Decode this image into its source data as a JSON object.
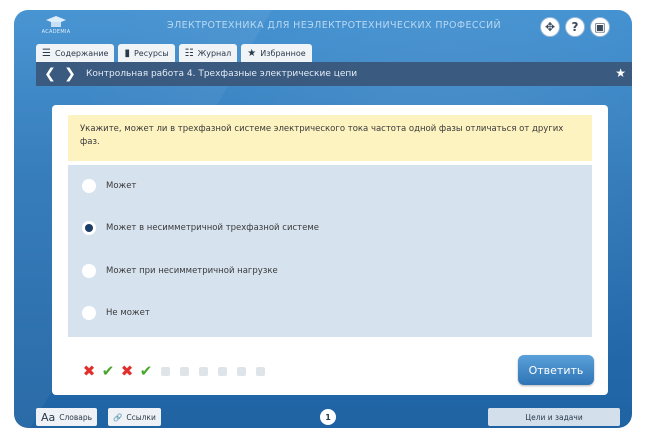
{
  "header": {
    "logo_text": "ACADEMIA",
    "title": "ЭЛЕКТРОТЕХНИКА ДЛЯ НЕЭЛЕКТРОТЕХНИЧЕСКИХ ПРОФЕССИЙ",
    "buttons": [
      {
        "name": "move-icon",
        "glyph": "✥"
      },
      {
        "name": "help-icon",
        "glyph": "?"
      },
      {
        "name": "save-icon",
        "glyph": "▣"
      }
    ]
  },
  "tabs": [
    {
      "label": "Содержание",
      "icon": "list-icon",
      "glyph": "☰"
    },
    {
      "label": "Ресурсы",
      "icon": "bar-chart-icon",
      "glyph": "▮"
    },
    {
      "label": "Журнал",
      "icon": "journal-icon",
      "glyph": "☷"
    },
    {
      "label": "Избранное",
      "icon": "star-icon",
      "glyph": "★"
    }
  ],
  "nav": {
    "back_glyph": "❮",
    "forward_glyph": "❯",
    "title": "Контрольная работа 4. Трехфазные электрические цепи",
    "favorite_glyph": "★"
  },
  "question": {
    "text": "Укажите, может ли в трехфазной системе электрического тока частота одной фазы отличаться от других фаз."
  },
  "options": [
    {
      "label": "Может",
      "checked": false
    },
    {
      "label": "Может в несимметричной трехфазной системе",
      "checked": true
    },
    {
      "label": "Может при несимметричной нагрузке",
      "checked": false
    },
    {
      "label": "Не может",
      "checked": false
    }
  ],
  "progress": [
    "wrong",
    "right",
    "wrong",
    "right",
    "pending",
    "pending",
    "pending",
    "pending",
    "pending",
    "pending"
  ],
  "answer_button": {
    "label": "Ответить"
  },
  "footer": {
    "dictionary": {
      "glyph": "Aa",
      "label": "Словарь"
    },
    "links": {
      "glyph": "🔗",
      "label": "Ссылки"
    },
    "page": "1",
    "goals": "Цели и задачи"
  },
  "colors": {
    "frame": "#2c76b8",
    "navbar": "#3a5a80",
    "question_bg": "#fdf3c0",
    "options_bg": "#d6e2ee",
    "wrong": "#e0302e",
    "right": "#4aa62c"
  }
}
